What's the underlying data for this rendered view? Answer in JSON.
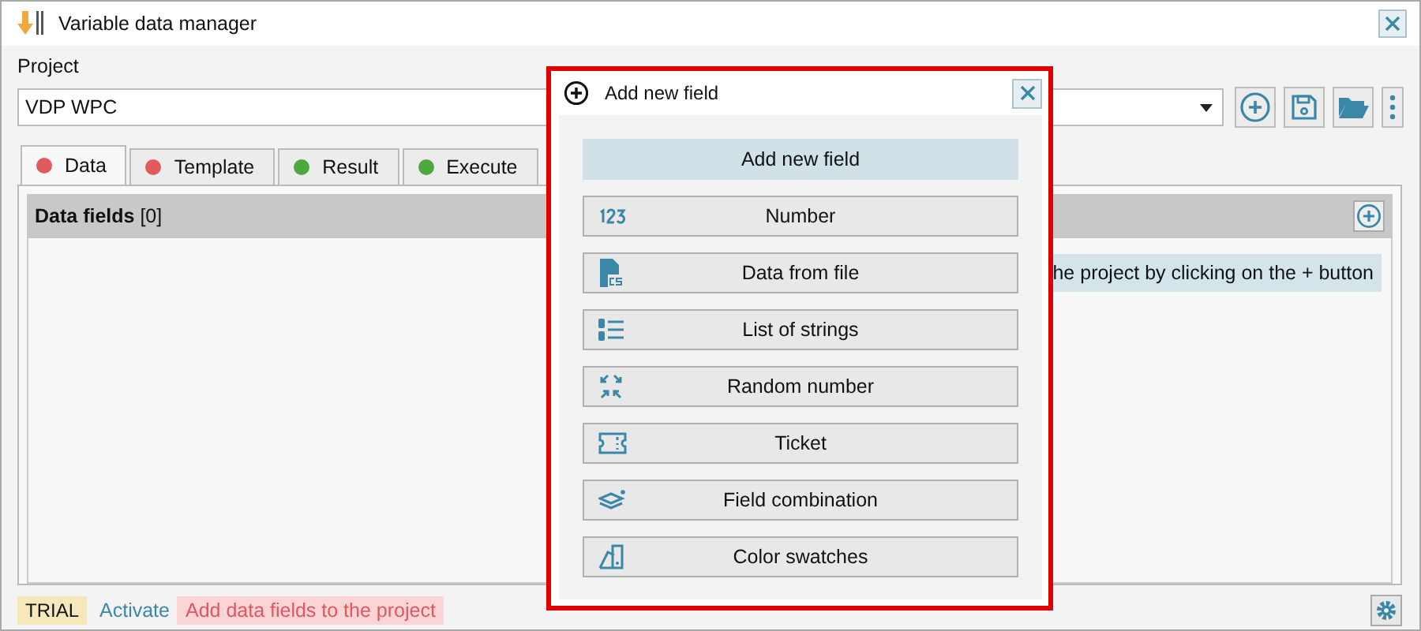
{
  "window": {
    "title": "Variable data manager"
  },
  "project": {
    "label": "Project",
    "value": "VDP WPC"
  },
  "toolbar": [
    {
      "kind": "add"
    },
    {
      "kind": "save"
    },
    {
      "kind": "open"
    },
    {
      "kind": "more"
    }
  ],
  "tabs": [
    {
      "label": "Data",
      "selected": true,
      "color": "#e05a5e"
    },
    {
      "label": "Template",
      "selected": false,
      "color": "#e05a5e"
    },
    {
      "label": "Result",
      "selected": false,
      "color": "#4fa83d"
    },
    {
      "label": "Execute",
      "selected": false,
      "color": "#4fa83d"
    }
  ],
  "panel": {
    "title": "Data fields",
    "count": "[0]",
    "hint": "he project by clicking on the + button"
  },
  "status_bar": {
    "license": "TRIAL",
    "activate": "Activate",
    "message": "Add data fields to the project"
  },
  "popup": {
    "title": "Add new field",
    "heading": "Add new field",
    "items": [
      {
        "kind": "number",
        "label": "Number"
      },
      {
        "kind": "csv",
        "label": "Data from file"
      },
      {
        "kind": "list",
        "label": "List of strings"
      },
      {
        "kind": "random",
        "label": "Random number"
      },
      {
        "kind": "ticket",
        "label": "Ticket"
      },
      {
        "kind": "combination",
        "label": "Field combination"
      },
      {
        "kind": "swatches",
        "label": "Color swatches"
      }
    ]
  }
}
